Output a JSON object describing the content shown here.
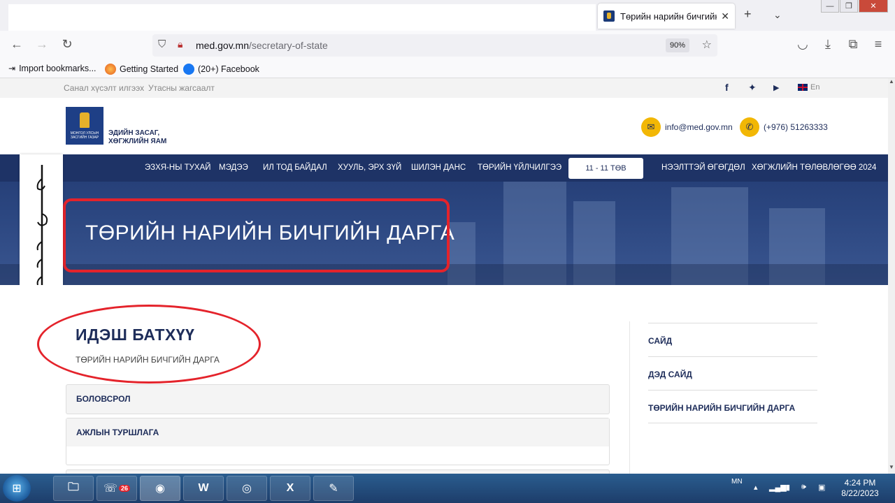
{
  "browser": {
    "tab_title": "Төрийн нарийн бичгийн д",
    "url_domain": "med.gov.mn",
    "url_path": "/secretary-of-state",
    "zoom": "90%",
    "bookmarks": [
      "Import bookmarks...",
      "Getting Started",
      "(20+) Facebook"
    ]
  },
  "site": {
    "top_links": [
      "Санал хүсэлт илгээх",
      "Утасны жагсаалт"
    ],
    "lang": "En",
    "logo_text": "МОНГОЛ УЛСЫН ЗАСГИЙН ГАЗАР",
    "org_name_line1": "ЭДИЙН ЗАСАГ,",
    "org_name_line2": "ХӨГЖЛИЙН ЯАМ",
    "email": "info@med.gov.mn",
    "phone": "(+976) 51263333",
    "menu": [
      "ЭЗХЯ-НЫ ТУХАЙ",
      "МЭДЭЭ",
      "ИЛ ТОД БАЙДАЛ",
      "ХУУЛЬ, ЭРХ ЗҮЙ",
      "ШИЛЭН ДАНС",
      "ТӨРИЙН ҮЙЛЧИЛГЭЭ",
      "11 - 11 ТӨВ",
      "НЭЭЛТТЭЙ ӨГӨГДӨЛ",
      "ХӨГЖЛИЙН ТӨЛӨВЛӨГӨӨ 2024"
    ],
    "hero_title": "ТӨРИЙН НАРИЙН БИЧГИЙН ДАРГА",
    "person_name": "ИДЭШ БАТХҮҮ",
    "person_role": "ТӨРИЙН НАРИЙН БИЧГИЙН ДАРГА",
    "accordions": [
      "БОЛОВСРОЛ",
      "АЖЛЫН ТУРШЛАГА"
    ],
    "sidebar": [
      "САЙД",
      "ДЭД САЙД",
      "ТӨРИЙН НАРИЙН БИЧГИЙН ДАРГА"
    ]
  },
  "taskbar": {
    "viber_badge": "26",
    "lang": "MN",
    "time": "4:24 PM",
    "date": "8/22/2023"
  },
  "colors": {
    "brand_navy": "#1e2d5a",
    "accent_yellow": "#f2b705",
    "annotation_red": "#e4232b"
  }
}
